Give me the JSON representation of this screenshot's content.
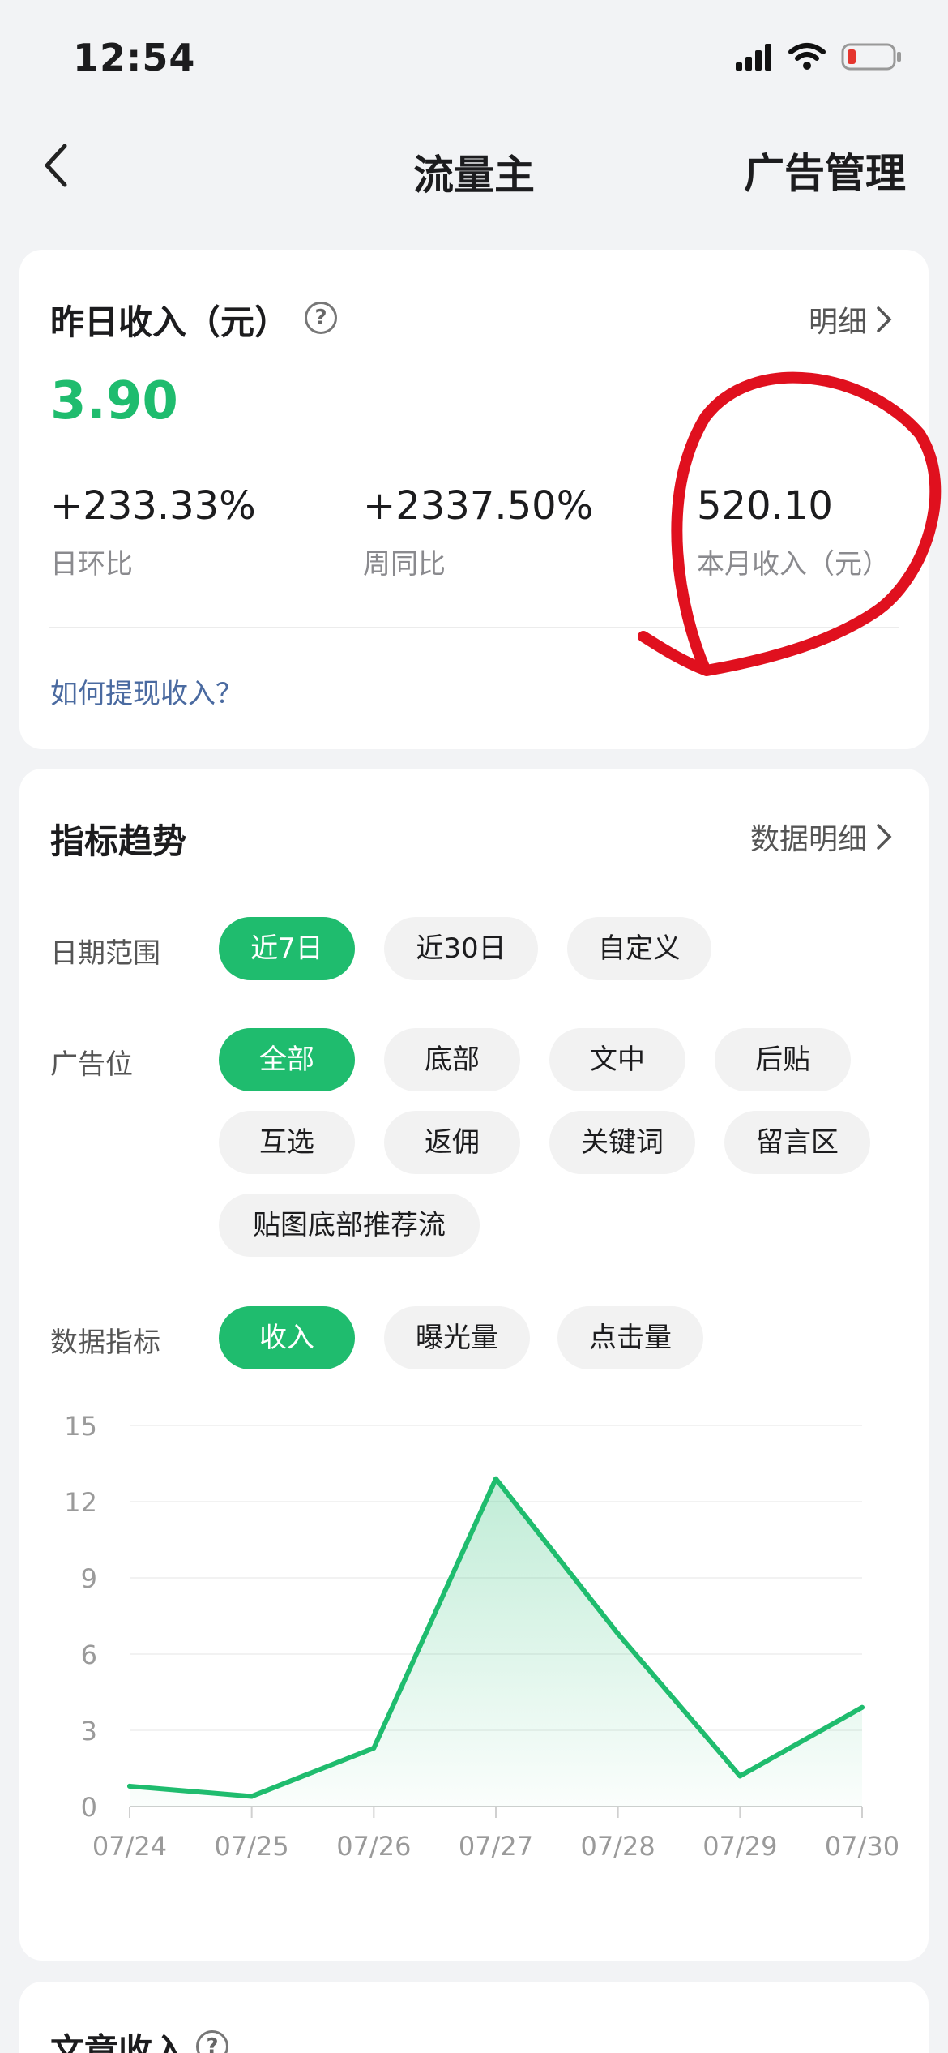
{
  "status": {
    "time": "12:54"
  },
  "nav": {
    "title": "流量主",
    "action": "广告管理"
  },
  "income": {
    "title": "昨日收入（元）",
    "detail": "明细",
    "yesterday_value": "3.90",
    "stats": [
      {
        "value": "+233.33%",
        "label": "日环比"
      },
      {
        "value": "+2337.50%",
        "label": "周同比"
      },
      {
        "value": "520.10",
        "label": "本月收入（元）"
      }
    ],
    "howto": "如何提现收入？"
  },
  "trend": {
    "title": "指标趋势",
    "detail": "数据明细",
    "date_label": "日期范围",
    "date_options": [
      "近7日",
      "近30日",
      "自定义"
    ],
    "ad_label": "广告位",
    "ad_options": [
      "全部",
      "底部",
      "文中",
      "后贴",
      "互选",
      "返佣",
      "关键词",
      "留言区",
      "贴图底部推荐流"
    ],
    "metric_label": "数据指标",
    "metric_options": [
      "收入",
      "曝光量",
      "点击量"
    ],
    "accent_color": "#1fbc6e"
  },
  "article": {
    "title": "文章收入"
  },
  "chart_data": {
    "type": "area",
    "categories": [
      "07/24",
      "07/25",
      "07/26",
      "07/27",
      "07/28",
      "07/29",
      "07/30"
    ],
    "values": [
      0.8,
      0.4,
      2.3,
      12.9,
      6.8,
      1.2,
      3.9
    ],
    "yticks": [
      0,
      3,
      6,
      9,
      12,
      15
    ],
    "ylim": [
      0,
      15
    ],
    "grid": true
  }
}
